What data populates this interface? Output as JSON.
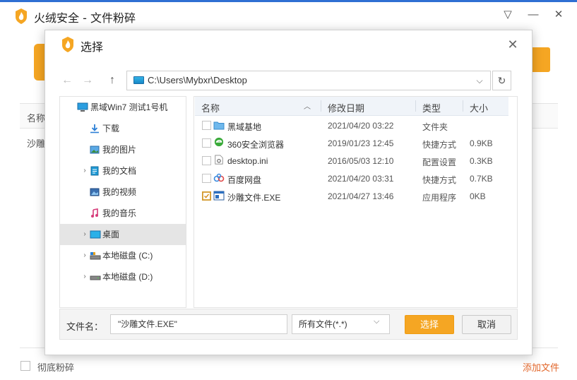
{
  "main": {
    "title": "火绒安全 - 文件粉碎",
    "table": {
      "col_name": "名称",
      "row_name": "沙雕"
    },
    "footer": {
      "checkbox_label": "彻底粉碎",
      "add_file_link": "添加文件"
    },
    "brand_color": "#f5a623"
  },
  "dialog": {
    "title": "选择",
    "address": "C:\\Users\\Mybxr\\Desktop",
    "tree": [
      {
        "label": "黑域Win7 测试1号机",
        "icon": "computer-icon",
        "expandable": false,
        "selected": false
      },
      {
        "label": "下载",
        "icon": "download-icon",
        "expandable": false,
        "selected": false
      },
      {
        "label": "我的图片",
        "icon": "pictures-icon",
        "expandable": false,
        "selected": false
      },
      {
        "label": "我的文档",
        "icon": "documents-icon",
        "expandable": true,
        "selected": false
      },
      {
        "label": "我的视频",
        "icon": "videos-icon",
        "expandable": false,
        "selected": false
      },
      {
        "label": "我的音乐",
        "icon": "music-icon",
        "expandable": false,
        "selected": false
      },
      {
        "label": "桌面",
        "icon": "desktop-icon",
        "expandable": true,
        "selected": true
      },
      {
        "label": "本地磁盘 (C:)",
        "icon": "drive-c-icon",
        "expandable": true,
        "selected": false
      },
      {
        "label": "本地磁盘 (D:)",
        "icon": "drive-d-icon",
        "expandable": true,
        "selected": false
      }
    ],
    "columns": {
      "name": "名称",
      "modified": "修改日期",
      "type": "类型",
      "size": "大小"
    },
    "files": [
      {
        "name": "黑域基地",
        "modified": "2021/04/20 03:22",
        "type": "文件夹",
        "size": "",
        "icon": "folder-icon",
        "checked": false
      },
      {
        "name": "360安全浏览器",
        "modified": "2019/01/23 12:45",
        "type": "快捷方式",
        "size": "0.9KB",
        "icon": "browser-icon",
        "checked": false
      },
      {
        "name": "desktop.ini",
        "modified": "2016/05/03 12:10",
        "type": "配置设置",
        "size": "0.3KB",
        "icon": "settings-file-icon",
        "checked": false
      },
      {
        "name": "百度网盘",
        "modified": "2021/04/20 03:31",
        "type": "快捷方式",
        "size": "0.7KB",
        "icon": "cloud-disk-icon",
        "checked": false
      },
      {
        "name": "沙雕文件.EXE",
        "modified": "2021/04/27 13:46",
        "type": "应用程序",
        "size": "0KB",
        "icon": "exe-icon",
        "checked": true
      }
    ],
    "filename_label": "文件名：",
    "filename_value": "\"沙雕文件.EXE\"",
    "filetype_value": "所有文件(*.*)",
    "select_button": "选择",
    "cancel_button": "取消"
  }
}
